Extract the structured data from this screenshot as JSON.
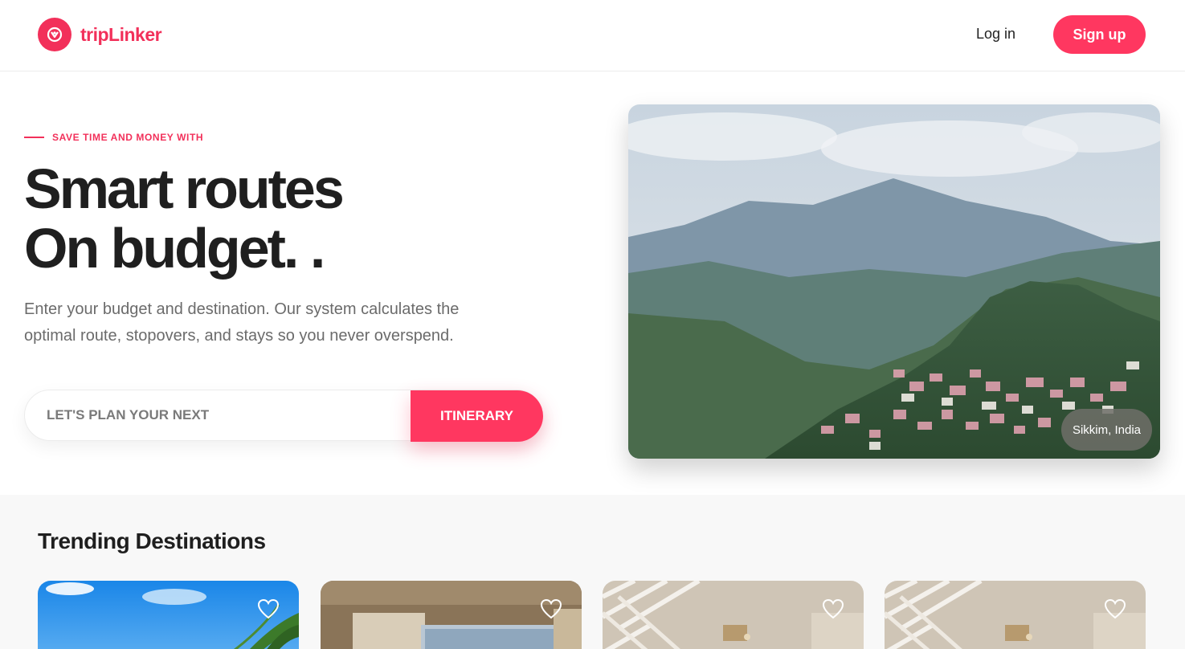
{
  "header": {
    "brand": "tripLinker",
    "login_label": "Log in",
    "signup_label": "Sign up"
  },
  "hero": {
    "eyebrow": "SAVE TIME AND MONEY WITH",
    "headline_line1": "Smart routes",
    "headline_line2": "On budget. .",
    "description": "Enter your budget and destination. Our system calculates the optimal route, stopovers, and stays so you never overspend.",
    "search_placeholder": "LET'S PLAN YOUR NEXT",
    "search_button": "ITINERARY",
    "image_location": "Sikkim, India"
  },
  "trending": {
    "title": "Trending Destinations",
    "cards": [
      {
        "icon": "heart-icon"
      },
      {
        "icon": "heart-icon"
      },
      {
        "icon": "heart-icon"
      },
      {
        "icon": "heart-icon"
      }
    ]
  },
  "colors": {
    "accent": "#ff3760",
    "brand": "#f2305a",
    "text_dark": "#1f1f1f",
    "text_muted": "#6b6b6b"
  }
}
